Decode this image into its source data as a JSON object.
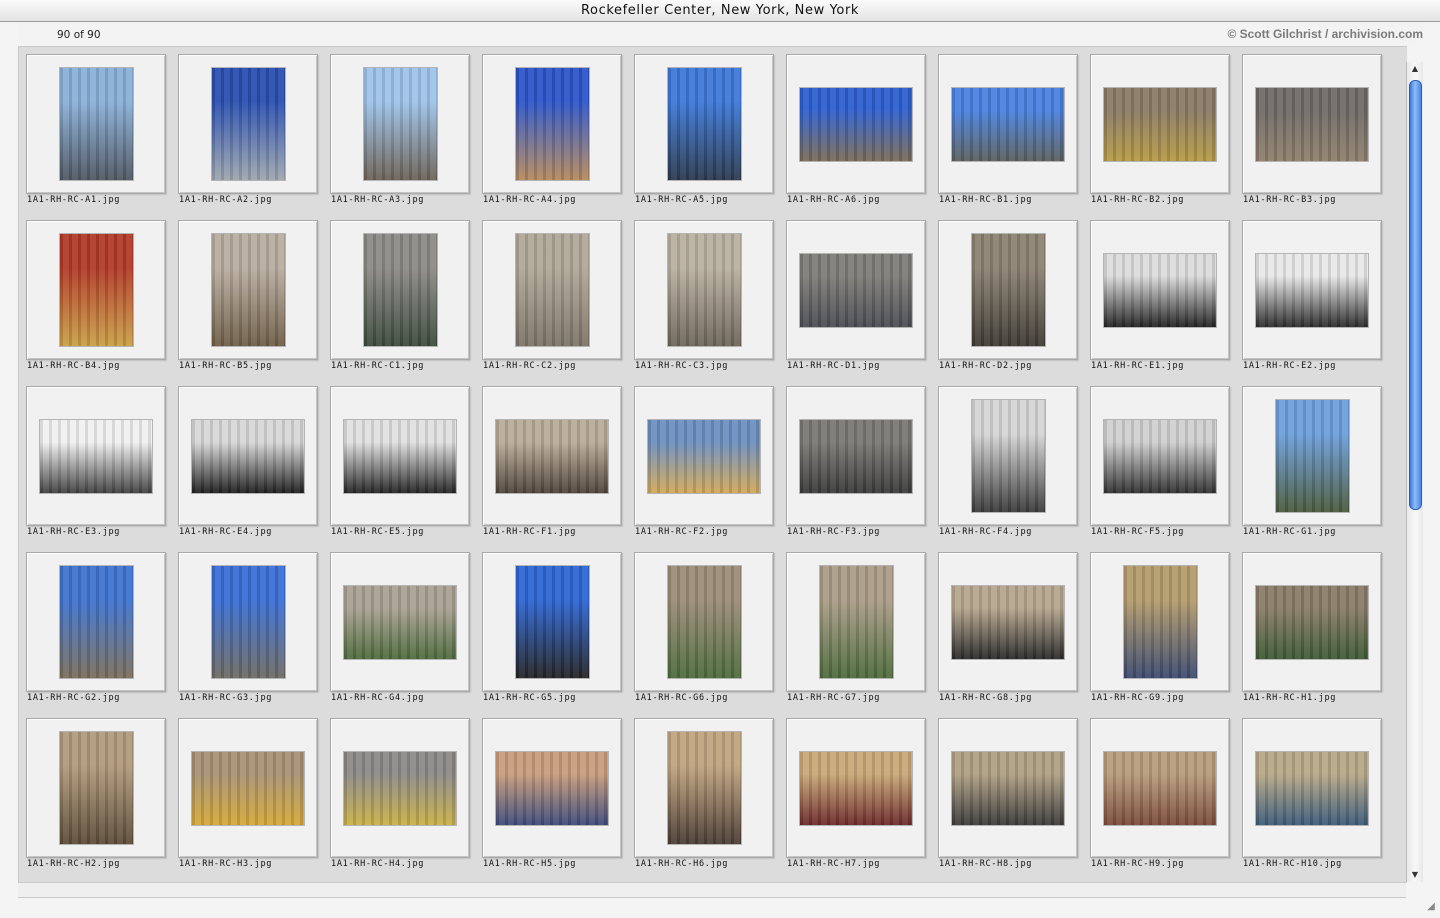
{
  "window": {
    "title": "Rockefeller Center, New York, New York"
  },
  "info": {
    "count": "90 of 90",
    "credit": "© Scott Gilchrist / archivision.com"
  },
  "icons": {
    "scroll_up": "triangle-up-icon",
    "scroll_down": "triangle-down-icon",
    "resize": "resize-grip-icon"
  },
  "thumbnails": [
    {
      "name": "1A1-RH-RC-A1.jpg",
      "orientation": "portrait",
      "palette": [
        "#8ab0d8",
        "#4f5762"
      ]
    },
    {
      "name": "1A1-RH-RC-A2.jpg",
      "orientation": "portrait",
      "palette": [
        "#2a4fb0",
        "#9ea6ad"
      ]
    },
    {
      "name": "1A1-RH-RC-A3.jpg",
      "orientation": "portrait",
      "palette": [
        "#9ec3ea",
        "#6c6256"
      ]
    },
    {
      "name": "1A1-RH-RC-A4.jpg",
      "orientation": "portrait",
      "palette": [
        "#2d55c9",
        "#b58a5d"
      ]
    },
    {
      "name": "1A1-RH-RC-A5.jpg",
      "orientation": "portrait",
      "palette": [
        "#3d78d8",
        "#2c3a4e"
      ]
    },
    {
      "name": "1A1-RH-RC-A6.jpg",
      "orientation": "landscape",
      "palette": [
        "#2e5fd0",
        "#7a6b55"
      ]
    },
    {
      "name": "1A1-RH-RC-B1.jpg",
      "orientation": "landscape",
      "palette": [
        "#4a82e0",
        "#5b5f5c"
      ]
    },
    {
      "name": "1A1-RH-RC-B2.jpg",
      "orientation": "landscape",
      "palette": [
        "#8a7a66",
        "#b59a45"
      ]
    },
    {
      "name": "1A1-RH-RC-B3.jpg",
      "orientation": "landscape",
      "palette": [
        "#6f6a66",
        "#8f7f6c"
      ]
    },
    {
      "name": "1A1-RH-RC-B4.jpg",
      "orientation": "portrait",
      "palette": [
        "#b23a28",
        "#c9a048"
      ]
    },
    {
      "name": "1A1-RH-RC-B5.jpg",
      "orientation": "portrait",
      "palette": [
        "#b8ad9f",
        "#6e5e48"
      ]
    },
    {
      "name": "1A1-RH-RC-C1.jpg",
      "orientation": "portrait",
      "palette": [
        "#8c8a86",
        "#3c4a3c"
      ]
    },
    {
      "name": "1A1-RH-RC-C2.jpg",
      "orientation": "portrait",
      "palette": [
        "#b0a898",
        "#7c7466"
      ]
    },
    {
      "name": "1A1-RH-RC-C3.jpg",
      "orientation": "portrait",
      "palette": [
        "#b9b0a0",
        "#6d6558"
      ]
    },
    {
      "name": "1A1-RH-RC-D1.jpg",
      "orientation": "landscape",
      "palette": [
        "#7e7c78",
        "#4a4c52"
      ]
    },
    {
      "name": "1A1-RH-RC-D2.jpg",
      "orientation": "portrait",
      "palette": [
        "#8c8272",
        "#3e3a34"
      ]
    },
    {
      "name": "1A1-RH-RC-E1.jpg",
      "orientation": "landscape",
      "palette": [
        "#dcdcdc",
        "#222222"
      ]
    },
    {
      "name": "1A1-RH-RC-E2.jpg",
      "orientation": "landscape",
      "palette": [
        "#e8e8e8",
        "#2a2a2a"
      ]
    },
    {
      "name": "1A1-RH-RC-E3.jpg",
      "orientation": "landscape",
      "palette": [
        "#f0f0f0",
        "#404040"
      ]
    },
    {
      "name": "1A1-RH-RC-E4.jpg",
      "orientation": "landscape",
      "palette": [
        "#d8d8d8",
        "#1e1e1e"
      ]
    },
    {
      "name": "1A1-RH-RC-E5.jpg",
      "orientation": "landscape",
      "palette": [
        "#e0e0e0",
        "#242424"
      ]
    },
    {
      "name": "1A1-RH-RC-F1.jpg",
      "orientation": "landscape",
      "palette": [
        "#b8ab98",
        "#4e4438"
      ]
    },
    {
      "name": "1A1-RH-RC-F2.jpg",
      "orientation": "landscape",
      "palette": [
        "#6c8fc0",
        "#d2a85a"
      ]
    },
    {
      "name": "1A1-RH-RC-F3.jpg",
      "orientation": "landscape",
      "palette": [
        "#7a7874",
        "#3a3a3a"
      ]
    },
    {
      "name": "1A1-RH-RC-F4.jpg",
      "orientation": "portrait",
      "palette": [
        "#d6d6d6",
        "#3a3a3a"
      ]
    },
    {
      "name": "1A1-RH-RC-F5.jpg",
      "orientation": "landscape",
      "palette": [
        "#d0d0d0",
        "#303030"
      ]
    },
    {
      "name": "1A1-RH-RC-G1.jpg",
      "orientation": "portrait",
      "palette": [
        "#6d9fdc",
        "#4b5a3c"
      ]
    },
    {
      "name": "1A1-RH-RC-G2.jpg",
      "orientation": "portrait",
      "palette": [
        "#3e73d0",
        "#7a6e5c"
      ]
    },
    {
      "name": "1A1-RH-RC-G3.jpg",
      "orientation": "portrait",
      "palette": [
        "#3a6fd6",
        "#6e6a62"
      ]
    },
    {
      "name": "1A1-RH-RC-G4.jpg",
      "orientation": "landscape",
      "palette": [
        "#a9a192",
        "#4e6a3c"
      ]
    },
    {
      "name": "1A1-RH-RC-G5.jpg",
      "orientation": "portrait",
      "palette": [
        "#2e66d4",
        "#242424"
      ]
    },
    {
      "name": "1A1-RH-RC-G6.jpg",
      "orientation": "portrait",
      "palette": [
        "#9b8c78",
        "#4e6a3c"
      ]
    },
    {
      "name": "1A1-RH-RC-G7.jpg",
      "orientation": "portrait",
      "palette": [
        "#aa9d88",
        "#4e6a3c"
      ]
    },
    {
      "name": "1A1-RH-RC-G8.jpg",
      "orientation": "landscape",
      "palette": [
        "#b6a68e",
        "#2a2a2a"
      ]
    },
    {
      "name": "1A1-RH-RC-G9.jpg",
      "orientation": "portrait",
      "palette": [
        "#b49c6c",
        "#3c4a6e"
      ]
    },
    {
      "name": "1A1-RH-RC-H1.jpg",
      "orientation": "landscape",
      "palette": [
        "#8a7c68",
        "#3e5a34"
      ]
    },
    {
      "name": "1A1-RH-RC-H2.jpg",
      "orientation": "portrait",
      "palette": [
        "#b09a7c",
        "#5c4c38"
      ]
    },
    {
      "name": "1A1-RH-RC-H3.jpg",
      "orientation": "landscape",
      "palette": [
        "#a89274",
        "#d4a838"
      ]
    },
    {
      "name": "1A1-RH-RC-H4.jpg",
      "orientation": "landscape",
      "palette": [
        "#8c8a88",
        "#c8b048"
      ]
    },
    {
      "name": "1A1-RH-RC-H5.jpg",
      "orientation": "landscape",
      "palette": [
        "#c89c7c",
        "#3e4a7a"
      ]
    },
    {
      "name": "1A1-RH-RC-H6.jpg",
      "orientation": "portrait",
      "palette": [
        "#c0a480",
        "#4a3c34"
      ]
    },
    {
      "name": "1A1-RH-RC-H7.jpg",
      "orientation": "landscape",
      "palette": [
        "#c8a878",
        "#6c2a2a"
      ]
    },
    {
      "name": "1A1-RH-RC-H8.jpg",
      "orientation": "landscape",
      "palette": [
        "#b0a084",
        "#3a3a3a"
      ]
    },
    {
      "name": "1A1-RH-RC-H9.jpg",
      "orientation": "landscape",
      "palette": [
        "#b89c7c",
        "#7a4a3a"
      ]
    },
    {
      "name": "1A1-RH-RC-H10.jpg",
      "orientation": "landscape",
      "palette": [
        "#b8a888",
        "#3c5a78"
      ]
    }
  ]
}
